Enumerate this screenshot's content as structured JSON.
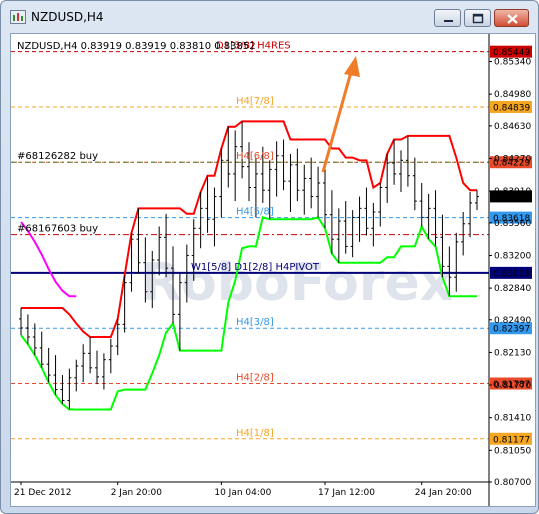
{
  "window": {
    "title": "NZDUSD,H4",
    "buttons": [
      "minimize",
      "maximize",
      "close"
    ]
  },
  "header": {
    "symbol_line": "NZDUSD,H4  0.83919 0.83919 0.83810 0.83852"
  },
  "watermark": "RoboForex",
  "chart_data": {
    "type": "candlestick",
    "symbol": "NZDUSD",
    "timeframe": "H4",
    "ohlc_last": {
      "open": 0.83919,
      "high": 0.83919,
      "low": 0.8381,
      "close": 0.83852
    },
    "ylim": [
      0.807,
      0.856
    ],
    "y_ticks": [
      "0.85340",
      "0.84980",
      "0.84630",
      "0.84270",
      "0.83910",
      "0.83560",
      "0.83200",
      "0.82840",
      "0.82490",
      "0.82130",
      "0.81770",
      "0.81410",
      "0.81050",
      "0.80700"
    ],
    "x_ticks": [
      "21 Dec 2012",
      "2 Jan 20:00",
      "10 Jan 04:00",
      "17 Jan 12:00",
      "24 Jan 20:00"
    ],
    "levels": [
      {
        "label": "D1[3/8] H4RES",
        "price": "0.85449",
        "value": 0.85449,
        "color": "#cc0000",
        "style": "dashed"
      },
      {
        "label": "H4[7/8]",
        "price": "0.84839",
        "value": 0.84839,
        "color": "#f5a623",
        "style": "dashed"
      },
      {
        "label": "H4[6/8]",
        "price": "0.84229",
        "value": 0.84229,
        "color": "#e84a2a",
        "style": "dashed"
      },
      {
        "label": "H4[5/8]",
        "price": "0.83618",
        "value": 0.83618,
        "color": "#3399ee",
        "style": "dashed"
      },
      {
        "label": "W1[5/8] D1[2/8] H4PIVOT",
        "price": "0.83008",
        "value": 0.83008,
        "color": "#00007a",
        "style": "solid"
      },
      {
        "label": "H4[3/8]",
        "price": "0.82397",
        "value": 0.82397,
        "color": "#3399ee",
        "style": "dashed"
      },
      {
        "label": "H4[2/8]",
        "price": "0.81787",
        "value": 0.81787,
        "color": "#e84a2a",
        "style": "dashed"
      },
      {
        "label": "H4[1/8]",
        "price": "0.81177",
        "value": 0.81177,
        "color": "#f5a623",
        "style": "dashed"
      }
    ],
    "orders": [
      {
        "label": "#68126282 buy",
        "value": 0.84229
      },
      {
        "label": "#68167603 buy",
        "value": 0.8343
      }
    ],
    "current_price": {
      "price": "0.83852",
      "value": 0.83852
    },
    "series": [
      {
        "name": "Fractal channel upper",
        "color": "#ff0000"
      },
      {
        "name": "Fractal channel lower",
        "color": "#00ff00"
      },
      {
        "name": "Earlier channel",
        "color": "#ff00ff"
      }
    ],
    "annotation_arrow": {
      "direction": "up",
      "color": "#f07c2a"
    },
    "candles": [
      [
        0.825,
        0.8262,
        0.8232,
        0.824
      ],
      [
        0.824,
        0.8255,
        0.8222,
        0.823
      ],
      [
        0.823,
        0.8245,
        0.821,
        0.8218
      ],
      [
        0.8218,
        0.8236,
        0.8196,
        0.82
      ],
      [
        0.82,
        0.8218,
        0.818,
        0.8188
      ],
      [
        0.8188,
        0.821,
        0.8166,
        0.8172
      ],
      [
        0.8172,
        0.8188,
        0.8156,
        0.816
      ],
      [
        0.816,
        0.8195,
        0.815,
        0.8185
      ],
      [
        0.8185,
        0.8205,
        0.817,
        0.8198
      ],
      [
        0.8198,
        0.8222,
        0.818,
        0.8212
      ],
      [
        0.8212,
        0.823,
        0.819,
        0.8196
      ],
      [
        0.8196,
        0.8215,
        0.8178,
        0.8186
      ],
      [
        0.8186,
        0.8212,
        0.8172,
        0.8205
      ],
      [
        0.8205,
        0.8228,
        0.819,
        0.822
      ],
      [
        0.822,
        0.825,
        0.821,
        0.8244
      ],
      [
        0.8244,
        0.8298,
        0.8235,
        0.829
      ],
      [
        0.829,
        0.8345,
        0.828,
        0.8338
      ],
      [
        0.8338,
        0.8372,
        0.83,
        0.8312
      ],
      [
        0.8312,
        0.834,
        0.8268,
        0.828
      ],
      [
        0.828,
        0.8325,
        0.8262,
        0.8315
      ],
      [
        0.8315,
        0.8352,
        0.8298,
        0.834
      ],
      [
        0.834,
        0.8366,
        0.8296,
        0.8306
      ],
      [
        0.8306,
        0.833,
        0.8245,
        0.8255
      ],
      [
        0.8255,
        0.83,
        0.8215,
        0.829
      ],
      [
        0.829,
        0.8332,
        0.8268,
        0.832
      ],
      [
        0.832,
        0.836,
        0.8292,
        0.835
      ],
      [
        0.835,
        0.839,
        0.8328,
        0.8372
      ],
      [
        0.8372,
        0.8408,
        0.8345,
        0.836
      ],
      [
        0.836,
        0.8395,
        0.833,
        0.8385
      ],
      [
        0.8385,
        0.8438,
        0.8362,
        0.8425
      ],
      [
        0.8425,
        0.8462,
        0.8395,
        0.841
      ],
      [
        0.841,
        0.8458,
        0.838,
        0.844
      ],
      [
        0.844,
        0.8468,
        0.8405,
        0.8418
      ],
      [
        0.8418,
        0.8445,
        0.838,
        0.8395
      ],
      [
        0.8395,
        0.8428,
        0.8362,
        0.841
      ],
      [
        0.841,
        0.844,
        0.8378,
        0.8392
      ],
      [
        0.8392,
        0.8425,
        0.836,
        0.8415
      ],
      [
        0.8415,
        0.8446,
        0.8385,
        0.843
      ],
      [
        0.843,
        0.8448,
        0.8392,
        0.8402
      ],
      [
        0.8402,
        0.8432,
        0.8368,
        0.842
      ],
      [
        0.842,
        0.8438,
        0.838,
        0.8392
      ],
      [
        0.8392,
        0.842,
        0.8365,
        0.8405
      ],
      [
        0.8405,
        0.8428,
        0.8372,
        0.8385
      ],
      [
        0.8385,
        0.8418,
        0.8362,
        0.84
      ],
      [
        0.84,
        0.8425,
        0.835,
        0.8365
      ],
      [
        0.8365,
        0.8392,
        0.8322,
        0.8338
      ],
      [
        0.8338,
        0.8372,
        0.8312,
        0.8358
      ],
      [
        0.8358,
        0.838,
        0.8322,
        0.833
      ],
      [
        0.833,
        0.837,
        0.8318,
        0.8362
      ],
      [
        0.8362,
        0.8385,
        0.8335,
        0.8372
      ],
      [
        0.8372,
        0.8395,
        0.8342,
        0.835
      ],
      [
        0.835,
        0.8378,
        0.833,
        0.8368
      ],
      [
        0.8368,
        0.84,
        0.8352,
        0.8395
      ],
      [
        0.8395,
        0.8432,
        0.8378,
        0.8422
      ],
      [
        0.8422,
        0.8448,
        0.8398,
        0.841
      ],
      [
        0.841,
        0.8436,
        0.839,
        0.8425
      ],
      [
        0.8425,
        0.8452,
        0.8396,
        0.8408
      ],
      [
        0.8408,
        0.8428,
        0.837,
        0.838
      ],
      [
        0.838,
        0.84,
        0.8352,
        0.8362
      ],
      [
        0.8362,
        0.8388,
        0.8338,
        0.8372
      ],
      [
        0.8372,
        0.8392,
        0.833,
        0.834
      ],
      [
        0.834,
        0.8365,
        0.8296,
        0.8308
      ],
      [
        0.8308,
        0.833,
        0.8275,
        0.8296
      ],
      [
        0.8296,
        0.8345,
        0.828,
        0.8335
      ],
      [
        0.8335,
        0.8368,
        0.832,
        0.8355
      ],
      [
        0.8355,
        0.839,
        0.834,
        0.8378
      ],
      [
        0.8378,
        0.8392,
        0.837,
        0.8385
      ]
    ]
  }
}
